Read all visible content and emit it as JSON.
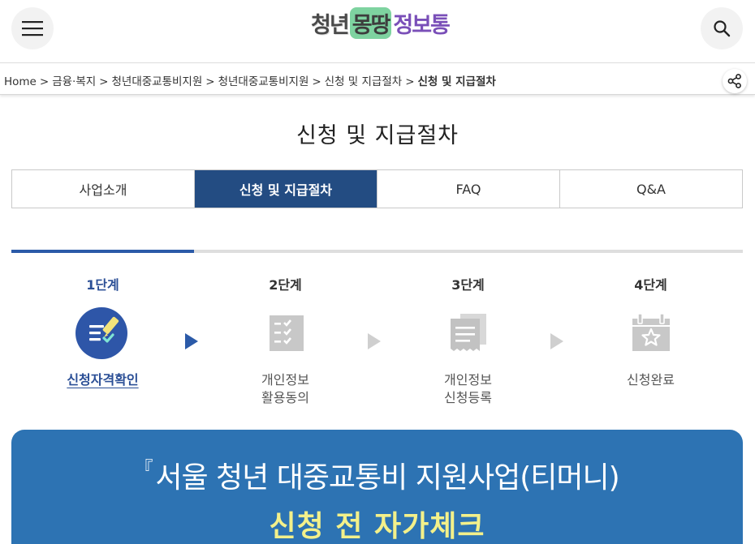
{
  "header": {
    "logo_part1": "청년",
    "logo_part2": "몽땅",
    "logo_part3": "정보통",
    "menu_icon": "hamburger-icon",
    "search_icon": "search-icon"
  },
  "breadcrumb": {
    "items": [
      "Home",
      "금융·복지",
      "청년대중교통비지원",
      "청년대중교통비지원",
      "신청 및 지급절차",
      "신청 및 지급절차"
    ],
    "separator": ">",
    "share_icon": "share-icon"
  },
  "page": {
    "title": "신청 및 지급절차"
  },
  "tabs": [
    {
      "label": "사업소개",
      "active": false
    },
    {
      "label": "신청 및 지급절차",
      "active": true
    },
    {
      "label": "FAQ",
      "active": false
    },
    {
      "label": "Q&A",
      "active": false
    }
  ],
  "steps": {
    "progress": 0.25,
    "items": [
      {
        "number": "1단계",
        "label": "신청자격확인",
        "icon": "checklist-pencil-icon",
        "active": true
      },
      {
        "number": "2단계",
        "label": "개인정보\n활용동의",
        "icon": "checklist-icon",
        "active": false
      },
      {
        "number": "3단계",
        "label": "개인정보\n신청등록",
        "icon": "documents-icon",
        "active": false
      },
      {
        "number": "4단계",
        "label": "신청완료",
        "icon": "calendar-star-icon",
        "active": false
      }
    ]
  },
  "banner": {
    "quote_mark": "『",
    "title": "서울 청년 대중교통비 지원사업(티머니)",
    "subtitle": "신청 전 자가체크"
  },
  "colors": {
    "primary": "#234c82",
    "accent_blue": "#2b5aa8",
    "banner_bg": "#2d73b3",
    "highlight": "#e7f27f",
    "banner_sub": "#f3f08a"
  }
}
